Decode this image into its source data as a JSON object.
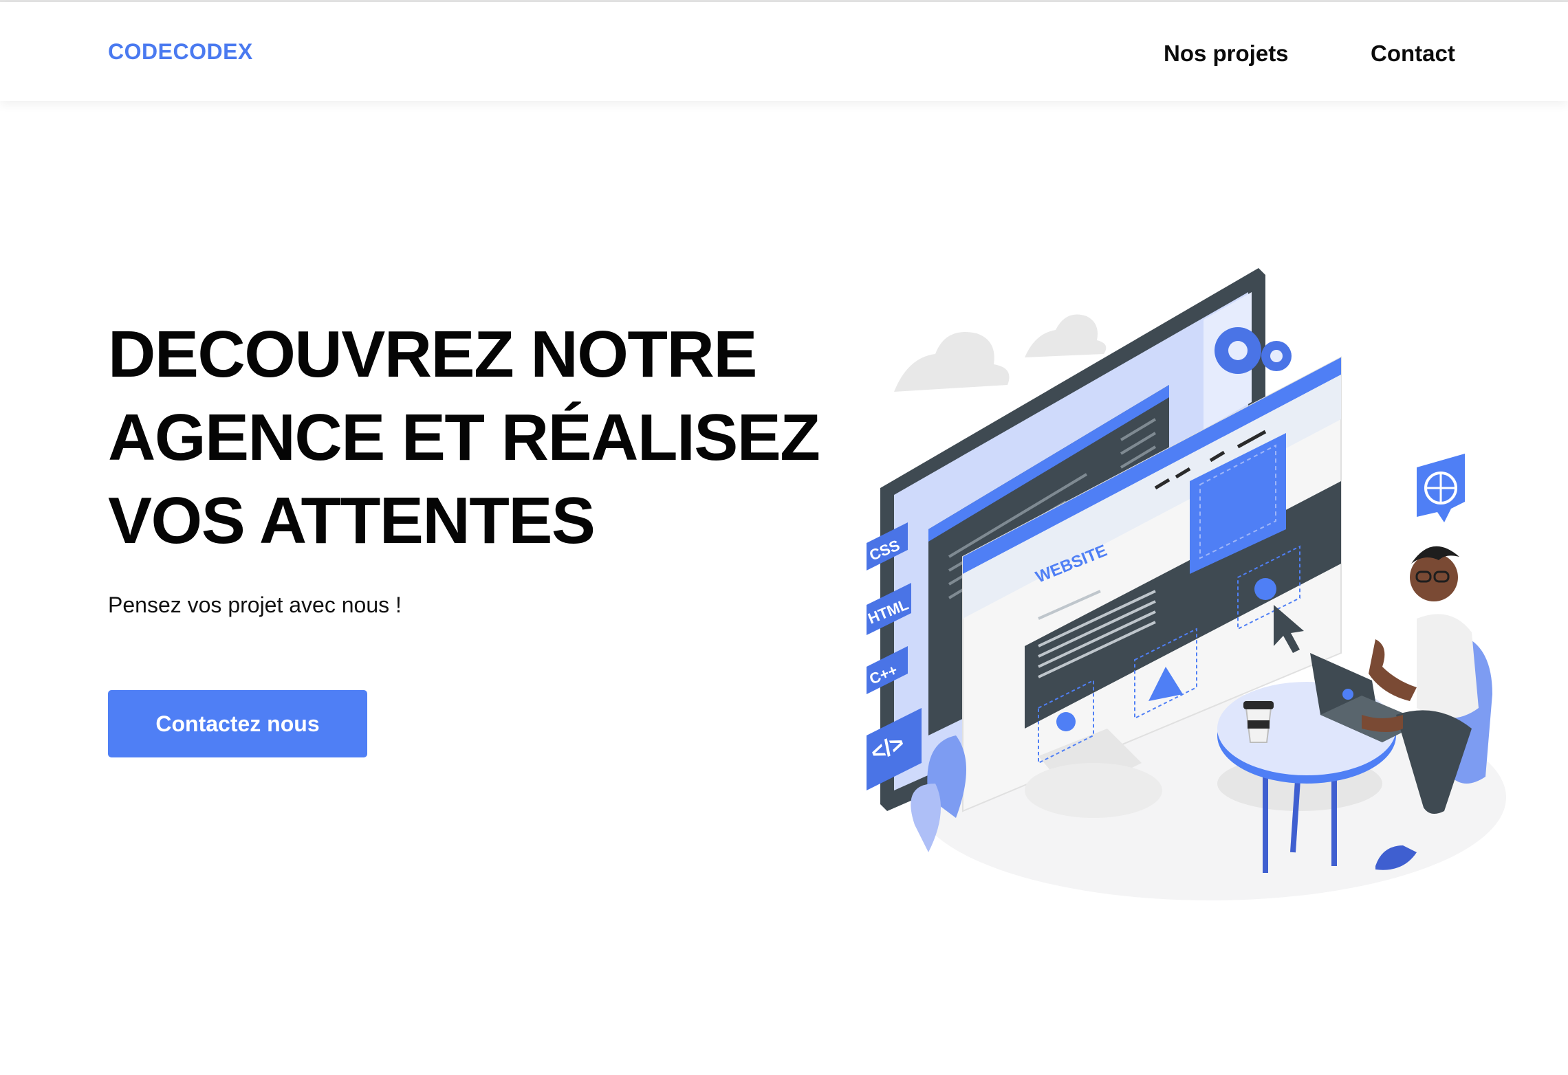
{
  "header": {
    "brand": "CODECODEX",
    "nav": [
      {
        "label": "Nos projets"
      },
      {
        "label": "Contact"
      }
    ]
  },
  "hero": {
    "title_lines": [
      "DECOUVREZ NOTRE",
      "AGENCE ET RÉALISEZ",
      "VOS ATTENTES"
    ],
    "subtitle": "Pensez vos projet avec nous !",
    "cta_label": "Contactez nous"
  },
  "illustration": {
    "tags": [
      "CSS",
      "HTML",
      "C++",
      "</>"
    ],
    "website_label": "WEBSITE"
  },
  "colors": {
    "accent": "#4f7ff5",
    "brand": "#4a7af0",
    "dark": "#455159",
    "light_blue": "#d6e0fc"
  }
}
